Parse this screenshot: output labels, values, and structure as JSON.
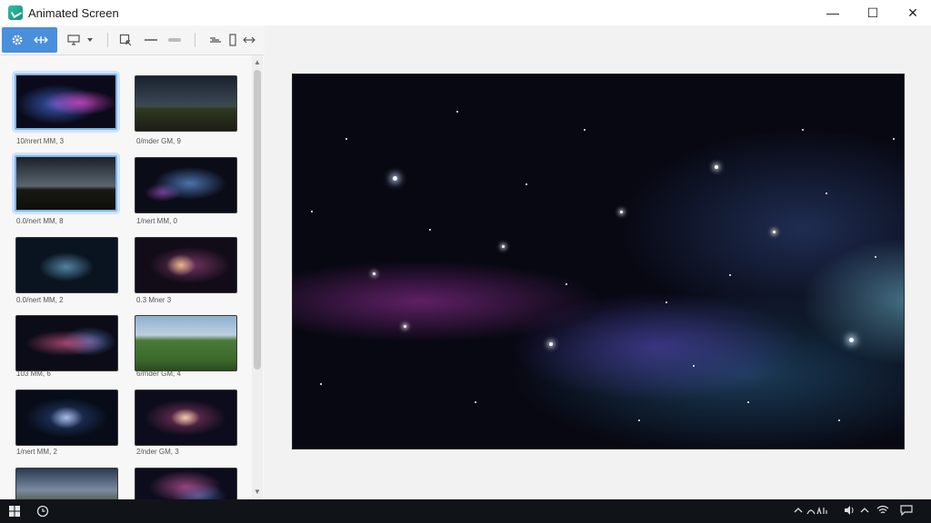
{
  "window": {
    "title": "Animated Screen"
  },
  "window_controls": {
    "minimize": "—",
    "maximize": "☐",
    "close": "✕"
  },
  "toolbar": {
    "settings_icon": "gear-icon",
    "expand_icon": "expand-arrows-icon",
    "monitor_icon": "monitor-icon",
    "dropdown_icon": "chevron-down-icon"
  },
  "thumbnails": [
    {
      "caption": "10/nrert MM, 3"
    },
    {
      "caption": "0/mder GM, 9"
    },
    {
      "caption": "0.0/nert MM, 8"
    },
    {
      "caption": "1/nert MM, 0"
    },
    {
      "caption": "0.0/nert MM, 2"
    },
    {
      "caption": "0.3 Mner 3"
    },
    {
      "caption": "103 MM, 6"
    },
    {
      "caption": "6/mder GM, 4"
    },
    {
      "caption": "1/nert MM, 2"
    },
    {
      "caption": "2/nder GM, 3"
    }
  ],
  "scroll": {
    "up": "▲",
    "down": "▼"
  }
}
